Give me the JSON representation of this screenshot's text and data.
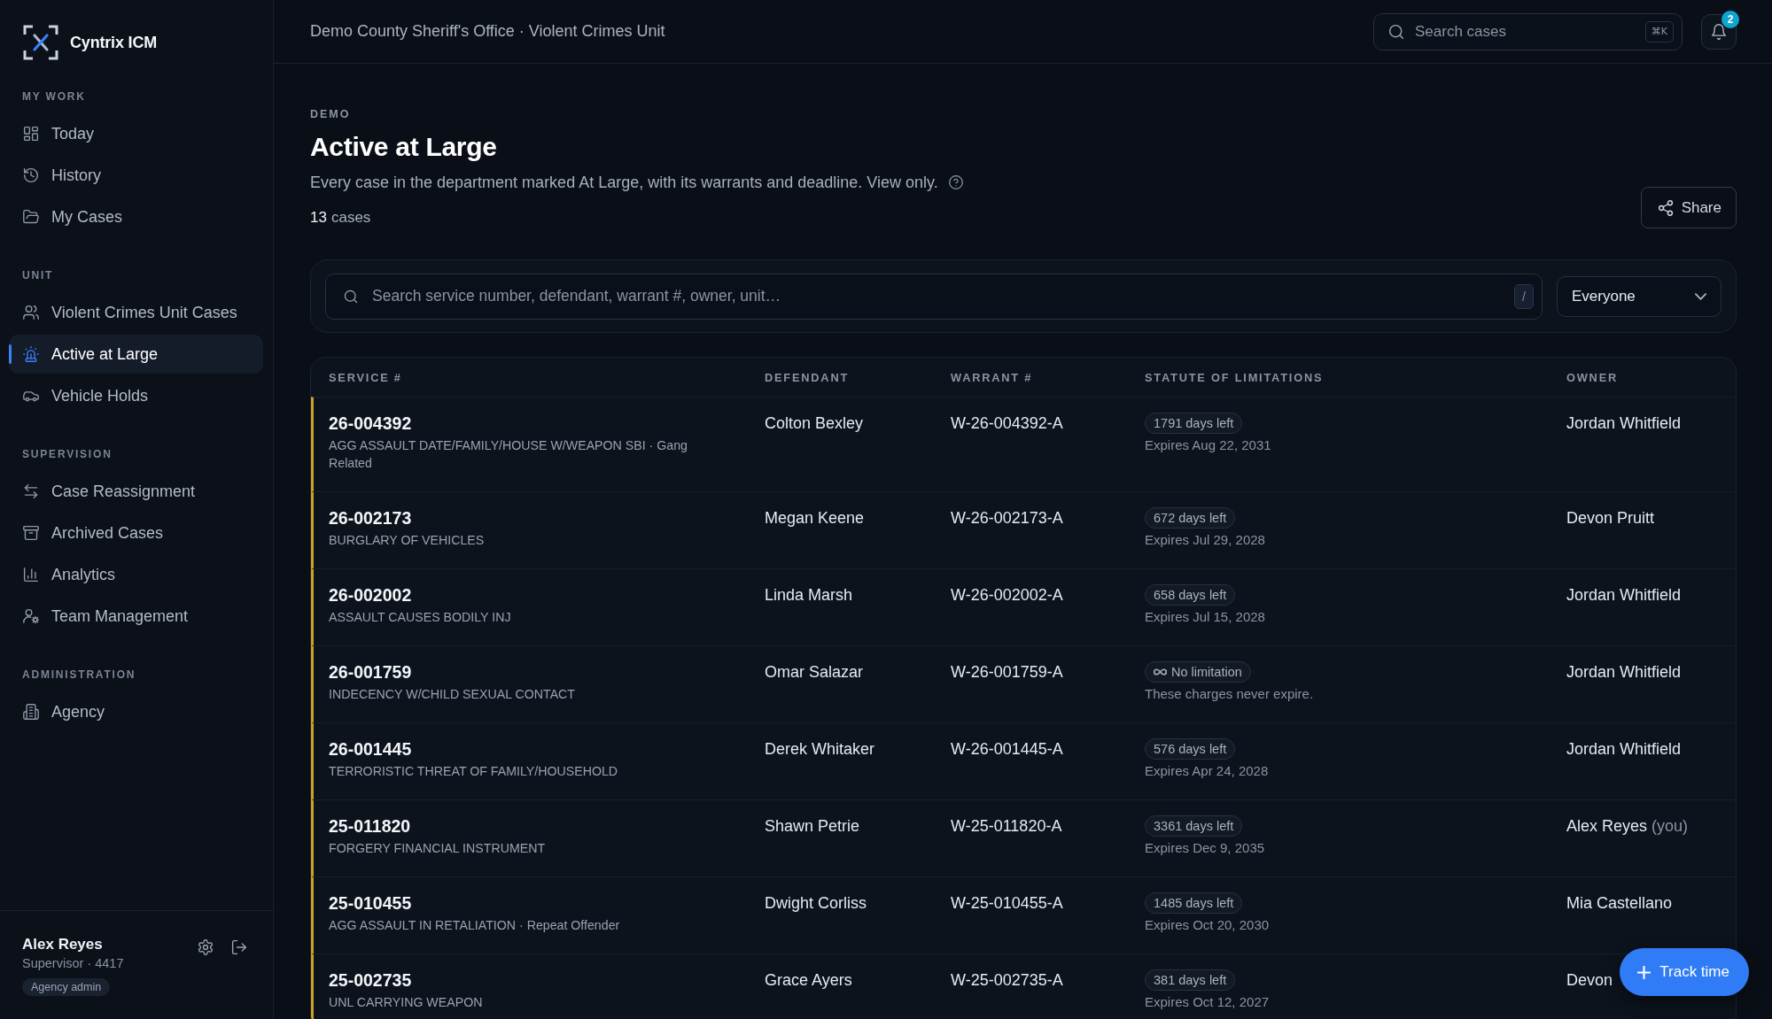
{
  "sidebar": {
    "brand": "Cyntrix ICM",
    "sections": [
      {
        "heading": "MY WORK",
        "items": [
          {
            "label": "Today",
            "selected": false
          },
          {
            "label": "History",
            "selected": false
          },
          {
            "label": "My Cases",
            "selected": false
          }
        ]
      },
      {
        "heading": "UNIT",
        "items": [
          {
            "label": "Violent Crimes Unit Cases",
            "selected": false
          },
          {
            "label": "Active at Large",
            "selected": true
          },
          {
            "label": "Vehicle Holds",
            "selected": false
          }
        ]
      },
      {
        "heading": "SUPERVISION",
        "items": [
          {
            "label": "Case Reassignment",
            "selected": false
          },
          {
            "label": "Archived Cases",
            "selected": false
          },
          {
            "label": "Analytics",
            "selected": false
          },
          {
            "label": "Team Management",
            "selected": false
          }
        ]
      },
      {
        "heading": "ADMINISTRATION",
        "items": [
          {
            "label": "Agency",
            "selected": false
          }
        ]
      }
    ],
    "user": {
      "name": "Alex Reyes",
      "role": "Supervisor · 4417",
      "badge": "Agency admin"
    }
  },
  "topbar": {
    "breadcrumb": "Demo County Sheriff's Office · Violent Crimes Unit",
    "search": {
      "placeholder": "Search cases",
      "shortcut": "⌘K"
    },
    "notifications": {
      "count": "2"
    }
  },
  "page": {
    "eyebrow": "DEMO",
    "title": "Active at Large",
    "description": "Every case in the department marked At Large, with its warrants and deadline. View only.",
    "count": "13",
    "count_label": "cases",
    "share_button": "Share"
  },
  "filters": {
    "search": {
      "placeholder": "Search service number, defendant, warrant #, owner, unit…",
      "shortcut": "/"
    },
    "owner_filter": {
      "value": "Everyone"
    }
  },
  "table": {
    "columns": [
      "SERVICE #",
      "DEFENDANT",
      "WARRANT #",
      "STATUTE OF LIMITATIONS",
      "OWNER"
    ],
    "rows": [
      {
        "service": "26-004392",
        "offense": "AGG ASSAULT DATE/FAMILY/HOUSE W/WEAPON SBI · Gang Related",
        "defendant": "Colton Bexley",
        "warrant": "W-26-004392-A",
        "statute": {
          "kind": "countdown",
          "badge": "1791 days left",
          "note": "Expires Aug 22, 2031"
        },
        "owner": "Jordan Whitfield"
      },
      {
        "service": "26-002173",
        "offense": "BURGLARY OF VEHICLES",
        "defendant": "Megan Keene",
        "warrant": "W-26-002173-A",
        "statute": {
          "kind": "countdown",
          "badge": "672 days left",
          "note": "Expires Jul 29, 2028"
        },
        "owner": "Devon Pruitt"
      },
      {
        "service": "26-002002",
        "offense": "ASSAULT CAUSES BODILY INJ",
        "defendant": "Linda Marsh",
        "warrant": "W-26-002002-A",
        "statute": {
          "kind": "countdown",
          "badge": "658 days left",
          "note": "Expires Jul 15, 2028"
        },
        "owner": "Jordan Whitfield"
      },
      {
        "service": "26-001759",
        "offense": "INDECENCY W/CHILD SEXUAL CONTACT",
        "defendant": "Omar Salazar",
        "warrant": "W-26-001759-A",
        "statute": {
          "kind": "none",
          "badge": "No limitation",
          "note": "These charges never expire."
        },
        "owner": "Jordan Whitfield"
      },
      {
        "service": "26-001445",
        "offense": "TERRORISTIC THREAT OF FAMILY/HOUSEHOLD",
        "defendant": "Derek Whitaker",
        "warrant": "W-26-001445-A",
        "statute": {
          "kind": "countdown",
          "badge": "576 days left",
          "note": "Expires Apr 24, 2028"
        },
        "owner": "Jordan Whitfield"
      },
      {
        "service": "25-011820",
        "offense": "FORGERY FINANCIAL INSTRUMENT",
        "defendant": "Shawn Petrie",
        "warrant": "W-25-011820-A",
        "statute": {
          "kind": "countdown",
          "badge": "3361 days left",
          "note": "Expires Dec 9, 2035"
        },
        "owner": "Alex Reyes",
        "owner_note": "(you)"
      },
      {
        "service": "25-010455",
        "offense": "AGG ASSAULT IN RETALIATION · Repeat Offender",
        "defendant": "Dwight Corliss",
        "warrant": "W-25-010455-A",
        "statute": {
          "kind": "countdown",
          "badge": "1485 days left",
          "note": "Expires Oct 20, 2030"
        },
        "owner": "Mia Castellano"
      },
      {
        "service": "25-002735",
        "offense": "UNL CARRYING WEAPON",
        "defendant": "Grace Ayers",
        "warrant": "W-25-002735-A",
        "statute": {
          "kind": "countdown",
          "badge": "381 days left",
          "note": "Expires Oct 12, 2027"
        },
        "owner": "Devon"
      }
    ]
  },
  "track_time_button": {
    "label": "Track time"
  }
}
